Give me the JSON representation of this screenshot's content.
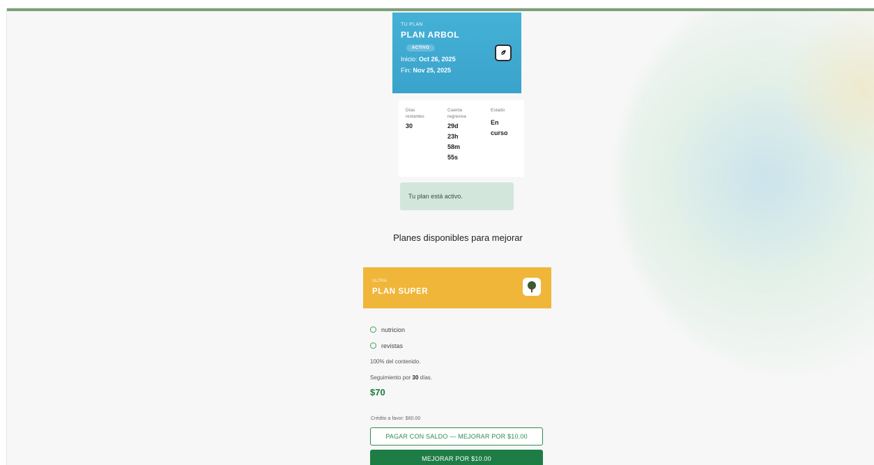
{
  "current_plan": {
    "eyebrow": "TU PLAN",
    "name": "PLAN ARBOL",
    "badge": "ACTIVO",
    "start_label": "Inicio:",
    "start_date": "Oct 26, 2025",
    "end_label": "Fin:",
    "end_date": "Nov 25, 2025",
    "icon": "leaf-icon"
  },
  "stats": {
    "days_label": "Días restantes",
    "days_value": "30",
    "countdown_label": "Cuenta regresiva",
    "countdown_days": "29d",
    "countdown_hours": "23h",
    "countdown_minutes": "58m",
    "countdown_seconds": "55s",
    "status_label": "Estado",
    "status_value_line1": "En",
    "status_value_line2": "curso"
  },
  "alert_text": "Tu plan está activo.",
  "section_title": "Planes disponibles para mejorar",
  "upgrade_plan": {
    "eyebrow": "ULTRA",
    "name": "PLAN SUPER",
    "icon": "tree-icon",
    "features": [
      "nutricion",
      "revistas"
    ],
    "content_text": "100% del contenido.",
    "tracking_prefix": "Seguimiento por",
    "tracking_days": "30",
    "tracking_suffix": "días.",
    "price": "$70",
    "credit_text": "Crédito a favor: $60.00",
    "pay_balance_label": "PAGAR CON SALDO — MEJORAR POR $10.00",
    "upgrade_label": "MEJORAR POR $10.00"
  },
  "colors": {
    "current_plan_bg": "#3aa3cc",
    "upgrade_plan_bg": "#f0b63a",
    "accent_green": "#1e7d45",
    "alert_bg": "#d3e6dc"
  }
}
